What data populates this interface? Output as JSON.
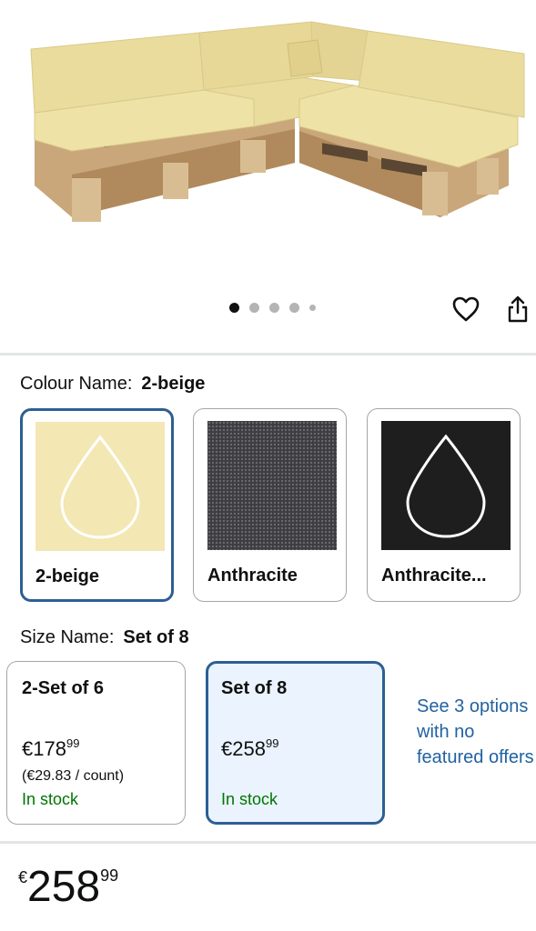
{
  "gallery": {
    "image_icon": "pallet-corner-sofa-image",
    "dot_count": 5,
    "active_index": 0,
    "wishlist_icon": "heart-icon",
    "share_icon": "share-icon"
  },
  "colour": {
    "label": "Colour Name:",
    "selected_value": "2-beige",
    "options": [
      {
        "name": "2-beige",
        "swatch_color": "#f3e7b3",
        "selected": true
      },
      {
        "name": "Anthracite",
        "swatch_color": "#3d3d40",
        "selected": false
      },
      {
        "name": "Anthracite...",
        "swatch_color": "#1e1e1e",
        "selected": false
      }
    ]
  },
  "size": {
    "label": "Size Name:",
    "selected_value": "Set of 8",
    "options": [
      {
        "title": "2-Set of 6",
        "currency": "€",
        "price_whole": "178",
        "price_fraction": "99",
        "unit_price": "(€29.83 / count)",
        "stock": "In stock",
        "selected": false
      },
      {
        "title": "Set of 8",
        "currency": "€",
        "price_whole": "258",
        "price_fraction": "99",
        "stock": "In stock",
        "selected": true
      }
    ],
    "more_options": "See 3 options with no featured offers"
  },
  "price": {
    "currency": "€",
    "whole": "258",
    "fraction": "99"
  },
  "colors": {
    "selected_border": "#2c5f94",
    "selected_bg": "#eaf3fe",
    "link": "#2162a1",
    "in_stock": "#007600"
  }
}
